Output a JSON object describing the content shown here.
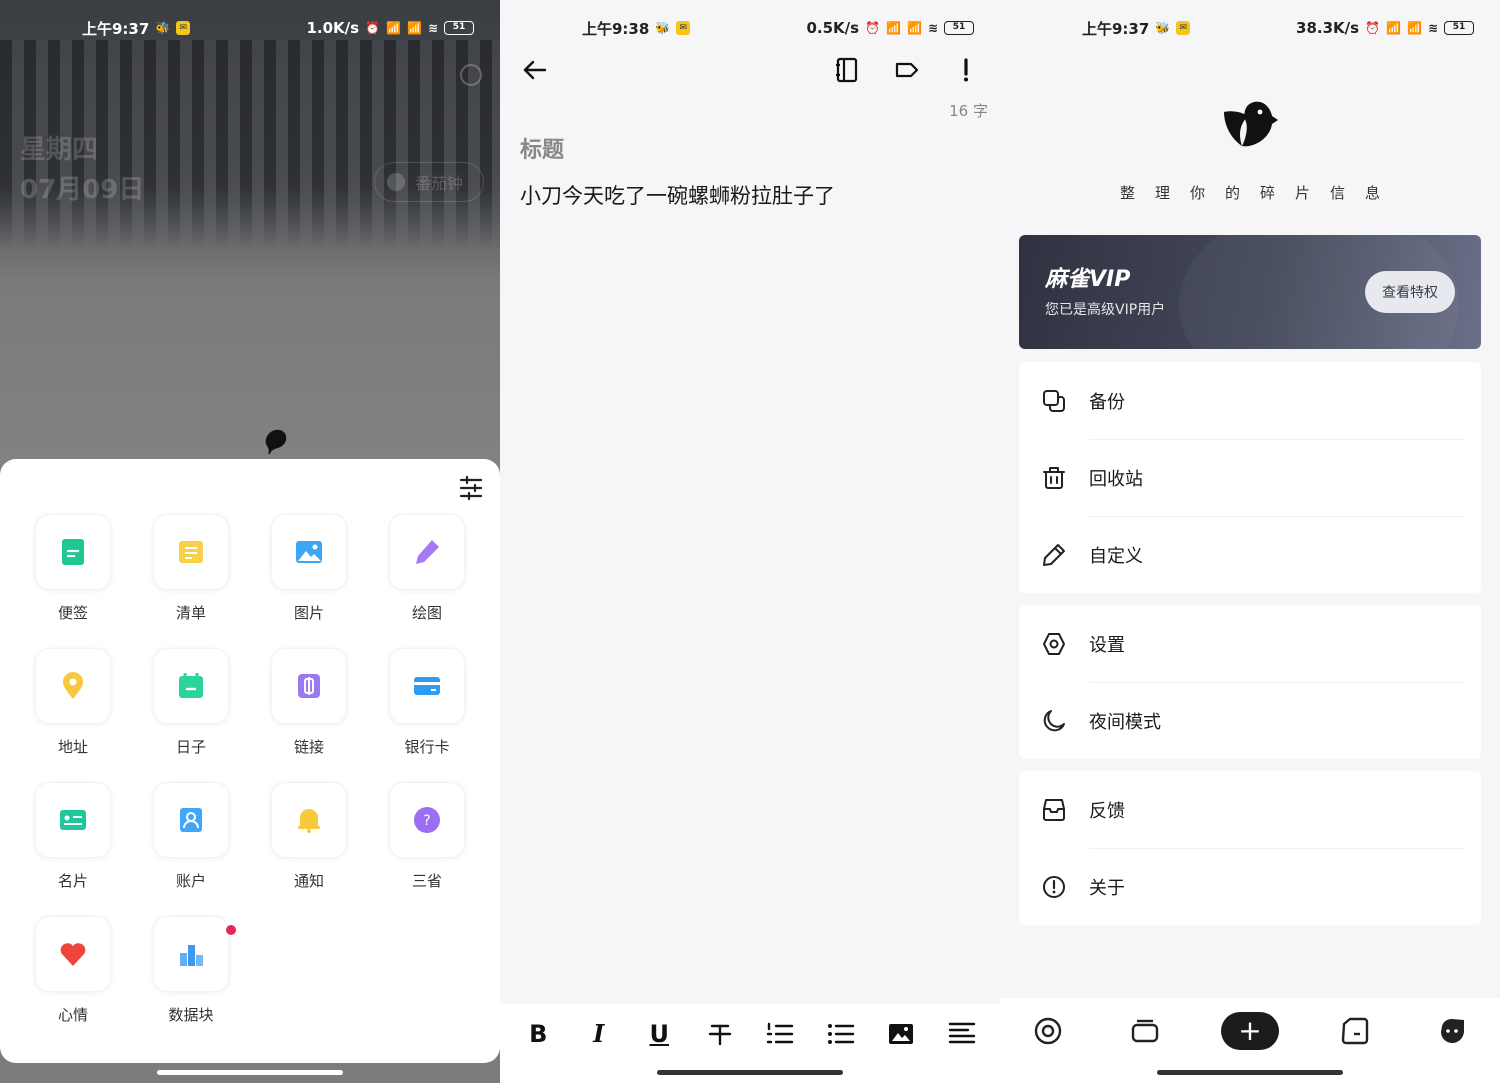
{
  "p1": {
    "status": {
      "time": "上午9:37",
      "speed": "1.0K/s",
      "battery": "51"
    },
    "date_weekday": "星期四",
    "date_day": "07月09日",
    "pomodoro": "番茄钟",
    "tiles": [
      {
        "label": "便签",
        "icon": "note-icon",
        "color": "#21c793"
      },
      {
        "label": "清单",
        "icon": "checklist-icon",
        "color": "#f7cf4a"
      },
      {
        "label": "图片",
        "icon": "image-icon",
        "color": "#3ba6f3"
      },
      {
        "label": "绘图",
        "icon": "pencil-icon",
        "color": "#a57af2"
      },
      {
        "label": "地址",
        "icon": "location-pin-icon",
        "color": "#f5c842"
      },
      {
        "label": "日子",
        "icon": "calendar-icon",
        "color": "#2cd39b"
      },
      {
        "label": "链接",
        "icon": "link-icon",
        "color": "#9a7af0"
      },
      {
        "label": "银行卡",
        "icon": "bank-card-icon",
        "color": "#2f9cf2"
      },
      {
        "label": "名片",
        "icon": "business-card-icon",
        "color": "#1fc79a"
      },
      {
        "label": "账户",
        "icon": "account-icon",
        "color": "#43a5f6"
      },
      {
        "label": "通知",
        "icon": "bell-icon",
        "color": "#f7c93d"
      },
      {
        "label": "三省",
        "icon": "question-bubble-icon",
        "color": "#9b6ef2"
      },
      {
        "label": "心情",
        "icon": "heart-icon",
        "color": "#f0453b"
      },
      {
        "label": "数据块",
        "icon": "bar-chart-icon",
        "color": "#3c9af3"
      }
    ]
  },
  "p2": {
    "status": {
      "time": "上午9:38",
      "speed": "0.5K/s",
      "battery": "51"
    },
    "count_number": "16",
    "count_unit": "字",
    "title_placeholder": "标题",
    "body": "小刀今天吃了一碗螺蛳粉拉肚子了",
    "toolbar": {
      "bold": "B",
      "italic": "I",
      "underline": "U"
    }
  },
  "p3": {
    "status": {
      "time": "上午9:37",
      "speed": "38.3K/s",
      "battery": "51"
    },
    "tagline": "整理你的碎片信息",
    "vip": {
      "title": "麻雀VIP",
      "subtitle": "您已是高级VIP用户",
      "button": "查看特权"
    },
    "menu_group1": [
      {
        "label": "备份",
        "icon": "backup-icon"
      },
      {
        "label": "回收站",
        "icon": "trash-icon"
      },
      {
        "label": "自定义",
        "icon": "edit-icon"
      }
    ],
    "menu_group2": [
      {
        "label": "设置",
        "icon": "settings-icon"
      },
      {
        "label": "夜间模式",
        "icon": "moon-icon"
      }
    ],
    "menu_group3": [
      {
        "label": "反馈",
        "icon": "feedback-icon"
      },
      {
        "label": "关于",
        "icon": "info-icon"
      }
    ],
    "fab": "+"
  }
}
